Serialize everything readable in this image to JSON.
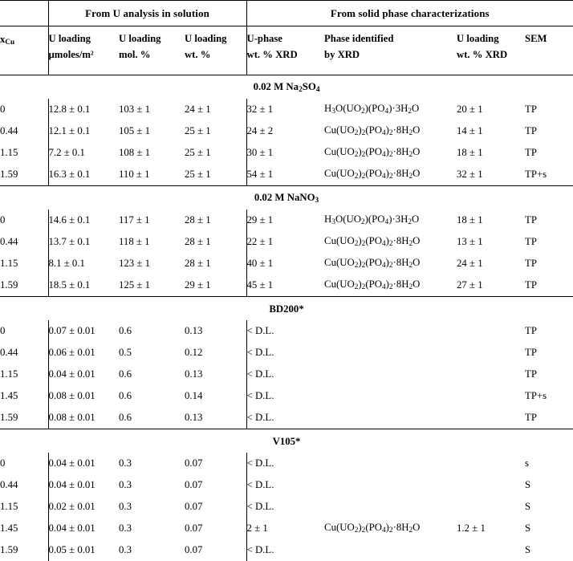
{
  "header": {
    "group_left": "From U analysis in solution",
    "group_right": "From solid phase characterizations",
    "col_xcu_main": "x",
    "col_xcu_sub": "Cu",
    "columns": [
      {
        "line1": "U loading",
        "line2_html": "µmoles/m²"
      },
      {
        "line1": "U loading",
        "line2_html": "mol. %"
      },
      {
        "line1": "U loading",
        "line2_html": "wt. %"
      },
      {
        "line1": "U-phase",
        "line2_html": "wt. % XRD"
      },
      {
        "line1": "Phase identified",
        "line2_html": "by XRD"
      },
      {
        "line1": "U loading",
        "line2_html": "wt. % XRD"
      },
      {
        "line1": "SEM",
        "line2_html": ""
      }
    ]
  },
  "sections": [
    {
      "title_parts": [
        {
          "t": "0.02 M Na",
          "sub": "2"
        },
        {
          "t": "SO",
          "sub": "4"
        }
      ],
      "title_plain": "0.02 M Na2SO4",
      "rows": [
        {
          "xcu": "0",
          "u_umol": "12.8 ± 0.1",
          "u_mol": "103 ± 1",
          "u_wt": "24 ± 1",
          "uphase": "32 ± 1",
          "phase": "H3O(UO2)(PO4)·3H2O",
          "uxrd": "20 ± 1",
          "sem": "TP"
        },
        {
          "xcu": "0.44",
          "u_umol": "12.1 ± 0.1",
          "u_mol": "105 ± 1",
          "u_wt": "25 ± 1",
          "uphase": "24 ± 2",
          "phase": "Cu(UO2)2(PO4)2·8H2O",
          "uxrd": "14 ± 1",
          "sem": "TP"
        },
        {
          "xcu": "1.15",
          "u_umol": "7.2 ± 0.1",
          "u_mol": "108 ± 1",
          "u_wt": "25 ± 1",
          "uphase": "30 ± 1",
          "phase": "Cu(UO2)2(PO4)2·8H2O",
          "uxrd": "18 ± 1",
          "sem": "TP"
        },
        {
          "xcu": "1.59",
          "u_umol": "16.3 ± 0.1",
          "u_mol": "110 ± 1",
          "u_wt": "25 ± 1",
          "uphase": "54 ± 1",
          "phase": "Cu(UO2)2(PO4)2·8H2O",
          "uxrd": "32 ± 1",
          "sem": "TP+s"
        }
      ]
    },
    {
      "title_parts": [
        {
          "t": "0.02 M NaNO",
          "sub": "3"
        }
      ],
      "title_plain": "0.02 M NaNO3",
      "rows": [
        {
          "xcu": "0",
          "u_umol": "14.6 ± 0.1",
          "u_mol": "117 ± 1",
          "u_wt": "28 ± 1",
          "uphase": "29 ± 1",
          "phase": "H3O(UO2)(PO4)·3H2O",
          "uxrd": "18 ± 1",
          "sem": "TP"
        },
        {
          "xcu": "0.44",
          "u_umol": "13.7 ± 0.1",
          "u_mol": "118 ± 1",
          "u_wt": "28 ± 1",
          "uphase": "22 ± 1",
          "phase": "Cu(UO2)2(PO4)2·8H2O",
          "uxrd": "13 ± 1",
          "sem": "TP"
        },
        {
          "xcu": "1.15",
          "u_umol": "8.1 ± 0.1",
          "u_mol": "123 ± 1",
          "u_wt": "28 ± 1",
          "uphase": "40 ± 1",
          "phase": "Cu(UO2)2(PO4)2·8H2O",
          "uxrd": "24 ± 1",
          "sem": "TP"
        },
        {
          "xcu": "1.59",
          "u_umol": "18.5 ± 0.1",
          "u_mol": "125 ± 1",
          "u_wt": "29 ± 1",
          "uphase": "45 ± 1",
          "phase": "Cu(UO2)2(PO4)2·8H2O",
          "uxrd": "27 ± 1",
          "sem": "TP"
        }
      ]
    },
    {
      "title_parts": [
        {
          "t": "BD200*",
          "sub": ""
        }
      ],
      "title_plain": "BD200*",
      "rows": [
        {
          "xcu": "0",
          "u_umol": "0.07 ± 0.01",
          "u_mol": "0.6",
          "u_wt": "0.13",
          "uphase": "< D.L.",
          "phase": "",
          "uxrd": "",
          "sem": "TP"
        },
        {
          "xcu": "0.44",
          "u_umol": "0.06 ± 0.01",
          "u_mol": "0.5",
          "u_wt": "0.12",
          "uphase": "< D.L.",
          "phase": "",
          "uxrd": "",
          "sem": "TP"
        },
        {
          "xcu": "1.15",
          "u_umol": "0.04 ± 0.01",
          "u_mol": "0.6",
          "u_wt": "0.13",
          "uphase": "< D.L.",
          "phase": "",
          "uxrd": "",
          "sem": "TP"
        },
        {
          "xcu": "1.45",
          "u_umol": "0.08 ± 0.01",
          "u_mol": "0.6",
          "u_wt": "0.14",
          "uphase": "< D.L.",
          "phase": "",
          "uxrd": "",
          "sem": "TP+s"
        },
        {
          "xcu": "1.59",
          "u_umol": "0.08 ± 0.01",
          "u_mol": "0.6",
          "u_wt": "0.13",
          "uphase": "< D.L.",
          "phase": "",
          "uxrd": "",
          "sem": "TP"
        }
      ]
    },
    {
      "title_parts": [
        {
          "t": "V105*",
          "sub": ""
        }
      ],
      "title_plain": "V105*",
      "rows": [
        {
          "xcu": "0",
          "u_umol": "0.04 ± 0.01",
          "u_mol": "0.3",
          "u_wt": "0.07",
          "uphase": "< D.L.",
          "phase": "",
          "uxrd": "",
          "sem": "s"
        },
        {
          "xcu": "0.44",
          "u_umol": "0.04 ± 0.01",
          "u_mol": "0.3",
          "u_wt": "0.07",
          "uphase": "< D.L.",
          "phase": "",
          "uxrd": "",
          "sem": "S"
        },
        {
          "xcu": "1.15",
          "u_umol": "0.02 ± 0.01",
          "u_mol": "0.3",
          "u_wt": "0.07",
          "uphase": "< D.L.",
          "phase": "",
          "uxrd": "",
          "sem": "S"
        },
        {
          "xcu": "1.45",
          "u_umol": "0.04 ± 0.01",
          "u_mol": "0.3",
          "u_wt": "0.07",
          "uphase": "2 ± 1",
          "phase": "Cu(UO2)2(PO4)2·8H2O",
          "uxrd": "1.2 ± 1",
          "sem": "S"
        },
        {
          "xcu": "1.59",
          "u_umol": "0.05 ± 0.01",
          "u_mol": "0.3",
          "u_wt": "0.07",
          "uphase": "< D.L.",
          "phase": "",
          "uxrd": "",
          "sem": "S"
        }
      ]
    }
  ]
}
